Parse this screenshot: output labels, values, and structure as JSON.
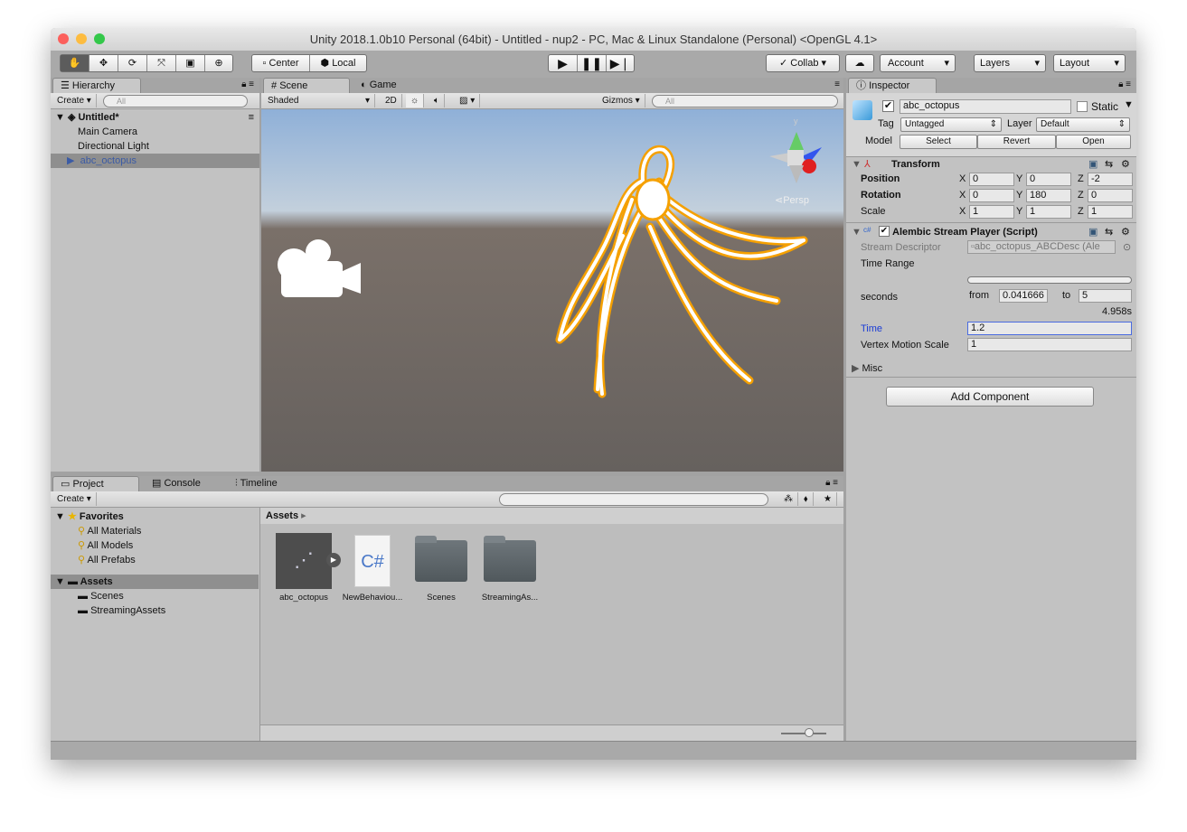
{
  "window": {
    "title": "Unity 2018.1.0b10 Personal (64bit) - Untitled - nup2 - PC, Mac & Linux Standalone (Personal) <OpenGL 4.1>"
  },
  "toolbar": {
    "tools": [
      "hand-tool",
      "move-tool",
      "rotate-tool",
      "scale-tool",
      "rect-tool",
      "transform-tool"
    ],
    "pivot": "Center",
    "space": "Local",
    "collab": "Collab",
    "account": "Account",
    "layers": "Layers",
    "layout": "Layout"
  },
  "hierarchy": {
    "tab": "Hierarchy",
    "create": "Create",
    "search_placeholder": "All",
    "scene": "Untitled*",
    "items": [
      "Main Camera",
      "Directional Light",
      "abc_octopus"
    ]
  },
  "scene": {
    "tabs": [
      "Scene",
      "Game"
    ],
    "shading": "Shaded",
    "mode2d": "2D",
    "gizmos": "Gizmos",
    "search_placeholder": "All",
    "persp": "Persp",
    "gizmo_axis": "y"
  },
  "inspector": {
    "tab": "Inspector",
    "name": "abc_octopus",
    "static": "Static",
    "tag_label": "Tag",
    "tag": "Untagged",
    "layer_label": "Layer",
    "layer": "Default",
    "model_label": "Model",
    "model_buttons": [
      "Select",
      "Revert",
      "Open"
    ],
    "transform": {
      "title": "Transform",
      "rows": [
        {
          "label": "Position",
          "x": "0",
          "y": "0",
          "z": "-2"
        },
        {
          "label": "Rotation",
          "x": "0",
          "y": "180",
          "z": "0"
        },
        {
          "label": "Scale",
          "x": "1",
          "y": "1",
          "z": "1"
        }
      ],
      "axes": [
        "X",
        "Y",
        "Z"
      ]
    },
    "alembic": {
      "title": "Alembic Stream Player (Script)",
      "descriptor_label": "Stream Descriptor",
      "descriptor": "abc_octopus_ABCDesc (Ale",
      "time_range": "Time Range",
      "seconds": "seconds",
      "from_label": "from",
      "from": "0.041666",
      "to_label": "to",
      "to": "5",
      "duration": "4.958s",
      "time_label": "Time",
      "time": "1.2",
      "vms_label": "Vertex Motion Scale",
      "vms": "1"
    },
    "misc": "Misc",
    "add_component": "Add Component"
  },
  "project": {
    "tabs": [
      "Project",
      "Console",
      "Timeline"
    ],
    "create": "Create",
    "favorites": "Favorites",
    "favorite_items": [
      "All Materials",
      "All Models",
      "All Prefabs"
    ],
    "assets_root": "Assets",
    "asset_folders": [
      "Scenes",
      "StreamingAssets"
    ],
    "breadcrumb": "Assets",
    "assets": [
      {
        "name": "abc_octopus",
        "type": "model"
      },
      {
        "name": "NewBehaviou...",
        "type": "script",
        "glyph": "C#"
      },
      {
        "name": "Scenes",
        "type": "folder"
      },
      {
        "name": "StreamingAs...",
        "type": "folder"
      }
    ]
  },
  "colors": {
    "selection": "#8f8f8f",
    "selected_text": "#3b5ba5",
    "outline": "#f5a000",
    "time_label": "#1a3cd6"
  }
}
